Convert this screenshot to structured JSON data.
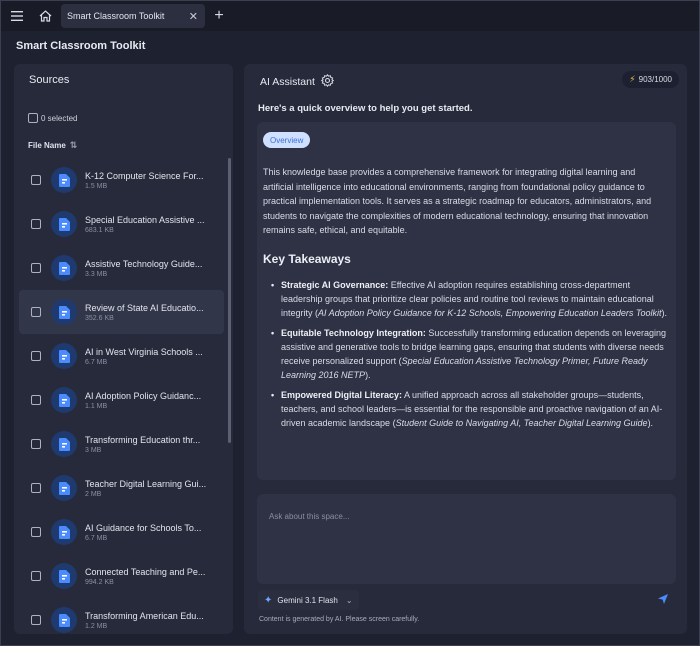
{
  "titlebar": {
    "tab_label": "Smart Classroom Toolkit",
    "icons": [
      "menu-icon",
      "home-icon",
      "close-icon",
      "plus-icon"
    ]
  },
  "app_title": "Smart Classroom Toolkit",
  "sources": {
    "title": "Sources",
    "select_all_label": "0 selected",
    "column_header": "File Name",
    "files": [
      {
        "name": "K-12 Computer Science For...",
        "size": "1.5 MB"
      },
      {
        "name": "Special Education Assistive ...",
        "size": "683.1 KB"
      },
      {
        "name": "Assistive Technology Guide...",
        "size": "3.3 MB"
      },
      {
        "name": "Review of State AI Educatio...",
        "size": "352.6 KB"
      },
      {
        "name": "AI in West Virginia Schools ...",
        "size": "6.7 MB"
      },
      {
        "name": "AI Adoption Policy Guidanc...",
        "size": "1.1 MB"
      },
      {
        "name": "Transforming Education thr...",
        "size": "3 MB"
      },
      {
        "name": "Teacher Digital Learning Gui...",
        "size": "2 MB"
      },
      {
        "name": "AI Guidance for Schools To...",
        "size": "6.7 MB"
      },
      {
        "name": "Connected Teaching and Pe...",
        "size": "994.2 KB"
      },
      {
        "name": "Transforming American Edu...",
        "size": "1.2 MB"
      }
    ]
  },
  "assistant": {
    "title": "AI Assistant",
    "credits": "903/1000",
    "intro": "Here's a quick overview to help you get started.",
    "overview_tag": "Overview",
    "overview_text": "This knowledge base provides a comprehensive framework for integrating digital learning and artificial intelligence into educational environments, ranging from foundational policy guidance to practical implementation tools. It serves as a strategic roadmap for educators, administrators, and students to navigate the complexities of modern educational technology, ensuring that innovation remains safe, ethical, and equitable.",
    "key_takeaways_title": "Key Takeaways",
    "takeaways": [
      {
        "heading": "Strategic AI Governance:",
        "body": " Effective AI adoption requires establishing cross-department leadership groups that prioritize clear policies and routine tool reviews to maintain educational integrity (",
        "source": "AI Adoption Policy Guidance for K-12 Schools, Empowering Education Leaders Toolkit",
        "end": ")."
      },
      {
        "heading": "Equitable Technology Integration:",
        "body": " Successfully transforming education depends on leveraging assistive and generative tools to bridge learning gaps, ensuring that students with diverse needs receive personalized support (",
        "source": "Special Education Assistive Technology Primer, Future Ready Learning 2016 NETP",
        "end": ")."
      },
      {
        "heading": "Empowered Digital Literacy:",
        "body": " A unified approach across all stakeholder groups—students, teachers, and school leaders—is essential for the responsible and proactive navigation of an AI-driven academic landscape (",
        "source": "Student Guide to Navigating AI, Teacher Digital Learning Guide",
        "end": ")."
      }
    ],
    "input_placeholder": "Ask about this space...",
    "model_name": "Gemini 3.1 Flash",
    "disclaimer": "Content is generated by AI. Please screen carefully."
  },
  "colors": {
    "accent_blue": "#4a8cff",
    "panel": "#262a3a",
    "card": "#2e3244",
    "background": "#1e2130"
  }
}
